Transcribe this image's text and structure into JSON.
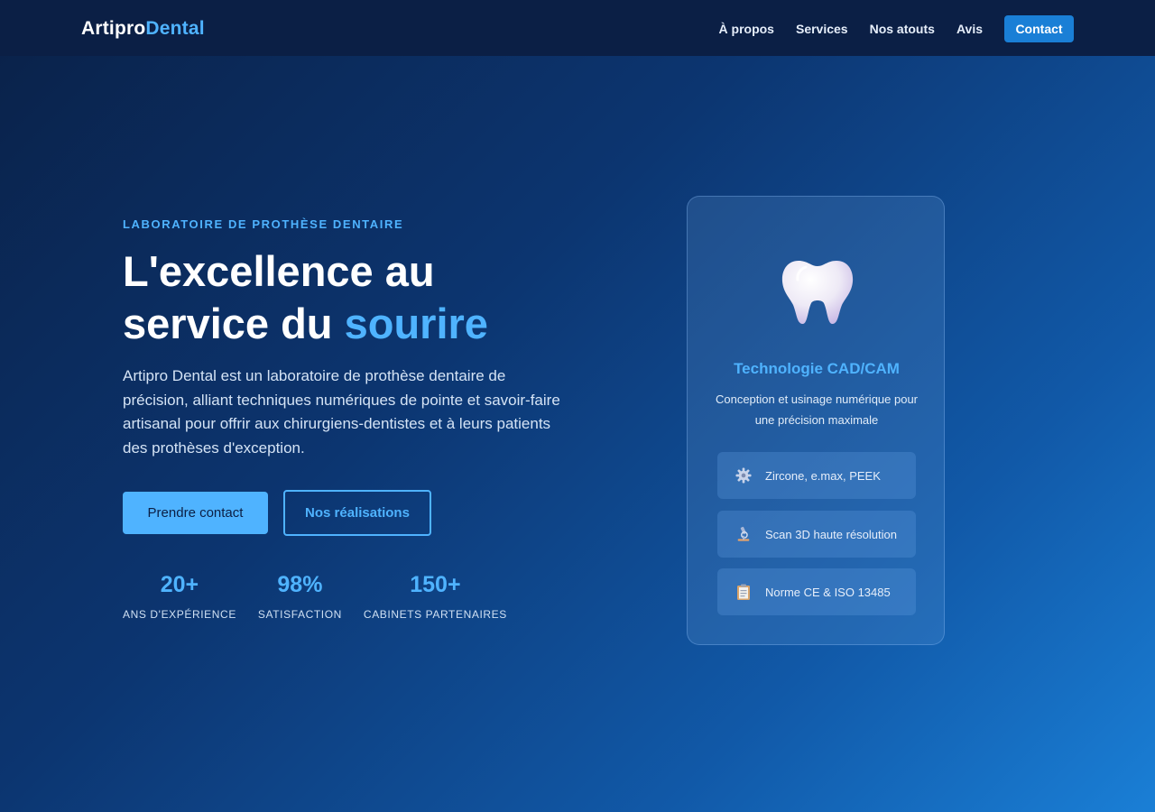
{
  "brand": {
    "name_part1": "Artipro",
    "name_part2": "Dental"
  },
  "nav": {
    "links": [
      "À propos",
      "Services",
      "Nos atouts",
      "Avis"
    ],
    "cta_label": "Contact"
  },
  "hero": {
    "eyebrow": "LABORATOIRE DE PROTHÈSE DENTAIRE",
    "headline_line1": "L'excellence au",
    "headline_line2_prefix": "service du ",
    "headline_accent": "sourire",
    "lead": "Artipro Dental est un laboratoire de prothèse dentaire de précision, alliant techniques numériques de pointe et savoir-faire artisanal pour offrir aux chirurgiens-dentistes et à leurs patients des prothèses d'exception.",
    "primary_button": "Prendre contact",
    "secondary_button": "Nos réalisations",
    "stats": [
      {
        "value": "20+",
        "label": "ANS D'EXPÉRIENCE"
      },
      {
        "value": "98%",
        "label": "SATISFACTION"
      },
      {
        "value": "150+",
        "label": "CABINETS PARTENAIRES"
      }
    ]
  },
  "card": {
    "icon": "tooth-icon",
    "title": "Technologie CAD/CAM",
    "description": "Conception et usinage numérique pour une précision maximale",
    "features": [
      {
        "icon": "gear-icon",
        "text": "Zircone, e.max, PEEK"
      },
      {
        "icon": "microscope-icon",
        "text": "Scan 3D haute résolution"
      },
      {
        "icon": "clipboard-icon",
        "text": "Norme CE & ISO 13485"
      }
    ]
  },
  "colors": {
    "accent": "#4fb3ff",
    "nav_bg": "#0b1f45",
    "cta_bg": "#1a7fd6"
  }
}
